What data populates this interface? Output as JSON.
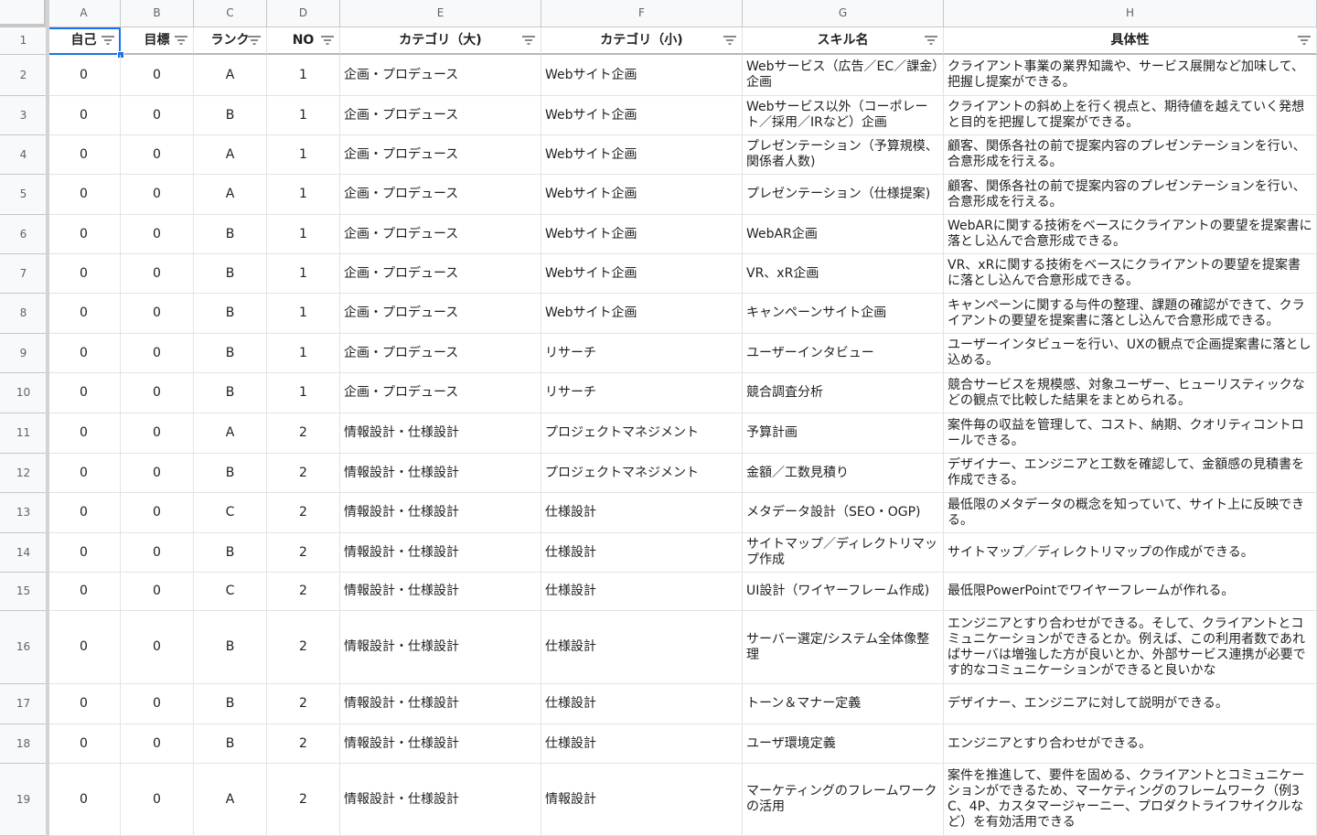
{
  "columns": [
    "A",
    "B",
    "C",
    "D",
    "E",
    "F",
    "G",
    "H"
  ],
  "header_row_number": "1",
  "headers": [
    "自己",
    "目標",
    "ランク",
    "NO",
    "カテゴリ（大)",
    "カテゴリ（小)",
    "スキル名",
    "具体性"
  ],
  "rows": [
    {
      "n": "2",
      "a": "0",
      "b": "0",
      "c": "A",
      "d": "1",
      "e": "企画・プロデュース",
      "f": "Webサイト企画",
      "g": "Webサービス（広告／EC／課金）企画",
      "h": "クライアント事業の業界知識や、サービス展開など加味して、把握し提案ができる。"
    },
    {
      "n": "3",
      "a": "0",
      "b": "0",
      "c": "B",
      "d": "1",
      "e": "企画・プロデュース",
      "f": "Webサイト企画",
      "g": "Webサービス以外（コーポレート／採用／IRなど）企画",
      "h": "クライアントの斜め上を行く視点と、期待値を越えていく発想と目的を把握して提案ができる。"
    },
    {
      "n": "4",
      "a": "0",
      "b": "0",
      "c": "A",
      "d": "1",
      "e": "企画・プロデュース",
      "f": "Webサイト企画",
      "g": "プレゼンテーション（予算規模、関係者人数)",
      "h": "顧客、関係各社の前で提案内容のプレゼンテーションを行い、合意形成を行える。"
    },
    {
      "n": "5",
      "a": "0",
      "b": "0",
      "c": "A",
      "d": "1",
      "e": "企画・プロデュース",
      "f": "Webサイト企画",
      "g": "プレゼンテーション（仕様提案)",
      "h": "顧客、関係各社の前で提案内容のプレゼンテーションを行い、合意形成を行える。"
    },
    {
      "n": "6",
      "a": "0",
      "b": "0",
      "c": "B",
      "d": "1",
      "e": "企画・プロデュース",
      "f": "Webサイト企画",
      "g": "WebAR企画",
      "h": "WebARに関する技術をベースにクライアントの要望を提案書に落とし込んで合意形成できる。"
    },
    {
      "n": "7",
      "a": "0",
      "b": "0",
      "c": "B",
      "d": "1",
      "e": "企画・プロデュース",
      "f": "Webサイト企画",
      "g": "VR、xR企画",
      "h": "VR、xRに関する技術をベースにクライアントの要望を提案書に落とし込んで合意形成できる。"
    },
    {
      "n": "8",
      "a": "0",
      "b": "0",
      "c": "B",
      "d": "1",
      "e": "企画・プロデュース",
      "f": "Webサイト企画",
      "g": "キャンペーンサイト企画",
      "h": "キャンペーンに関する与件の整理、課題の確認ができて、クライアントの要望を提案書に落とし込んで合意形成できる。"
    },
    {
      "n": "9",
      "a": "0",
      "b": "0",
      "c": "B",
      "d": "1",
      "e": "企画・プロデュース",
      "f": "リサーチ",
      "g": "ユーザーインタビュー",
      "h": "ユーザーインタビューを行い、UXの観点で企画提案書に落とし込める。"
    },
    {
      "n": "10",
      "a": "0",
      "b": "0",
      "c": "B",
      "d": "1",
      "e": "企画・プロデュース",
      "f": "リサーチ",
      "g": "競合調査分析",
      "h": "競合サービスを規模感、対象ユーザー、ヒューリスティックなどの観点で比較した結果をまとめられる。"
    },
    {
      "n": "11",
      "a": "0",
      "b": "0",
      "c": "A",
      "d": "2",
      "e": "情報設計・仕様設計",
      "f": "プロジェクトマネジメント",
      "g": "予算計画",
      "h": "案件毎の収益を管理して、コスト、納期、クオリティコントロールできる。"
    },
    {
      "n": "12",
      "a": "0",
      "b": "0",
      "c": "B",
      "d": "2",
      "e": "情報設計・仕様設計",
      "f": "プロジェクトマネジメント",
      "g": "金額／工数見積り",
      "h": "デザイナー、エンジニアと工数を確認して、金額感の見積書を作成できる。"
    },
    {
      "n": "13",
      "a": "0",
      "b": "0",
      "c": "C",
      "d": "2",
      "e": "情報設計・仕様設計",
      "f": "仕様設計",
      "g": "メタデータ設計（SEO・OGP)",
      "h": "最低限のメタデータの概念を知っていて、サイト上に反映できる。"
    },
    {
      "n": "14",
      "a": "0",
      "b": "0",
      "c": "B",
      "d": "2",
      "e": "情報設計・仕様設計",
      "f": "仕様設計",
      "g": "サイトマップ／ディレクトリマップ作成",
      "h": "サイトマップ／ディレクトリマップの作成ができる。"
    },
    {
      "n": "15",
      "a": "0",
      "b": "0",
      "c": "C",
      "d": "2",
      "e": "情報設計・仕様設計",
      "f": "仕様設計",
      "g": "UI設計（ワイヤーフレーム作成)",
      "h": "最低限PowerPointでワイヤーフレームが作れる。"
    },
    {
      "n": "16",
      "a": "0",
      "b": "0",
      "c": "B",
      "d": "2",
      "e": "情報設計・仕様設計",
      "f": "仕様設計",
      "g": "サーバー選定/システム全体像整理",
      "h": "エンジニアとすり合わせができる。そして、クライアントとコミュニケーションができるとか。例えば、この利用者数であればサーバは増強した方が良いとか、外部サービス連携が必要です的なコミュニケーションができると良いかな"
    },
    {
      "n": "17",
      "a": "0",
      "b": "0",
      "c": "B",
      "d": "2",
      "e": "情報設計・仕様設計",
      "f": "仕様設計",
      "g": "トーン＆マナー定義",
      "h": "デザイナー、エンジニアに対して説明ができる。"
    },
    {
      "n": "18",
      "a": "0",
      "b": "0",
      "c": "B",
      "d": "2",
      "e": "情報設計・仕様設計",
      "f": "仕様設計",
      "g": "ユーザ環境定義",
      "h": "エンジニアとすり合わせができる。"
    },
    {
      "n": "19",
      "a": "0",
      "b": "0",
      "c": "A",
      "d": "2",
      "e": "情報設計・仕様設計",
      "f": "情報設計",
      "g": "マーケティングのフレームワークの活用",
      "h": "案件を推進して、要件を固める、クライアントとコミュニケーションができるため、マーケティングのフレームワーク（例3C、4P、カスタマージャーニー、プロダクトライフサイクルなど）を有効活用できる"
    }
  ]
}
